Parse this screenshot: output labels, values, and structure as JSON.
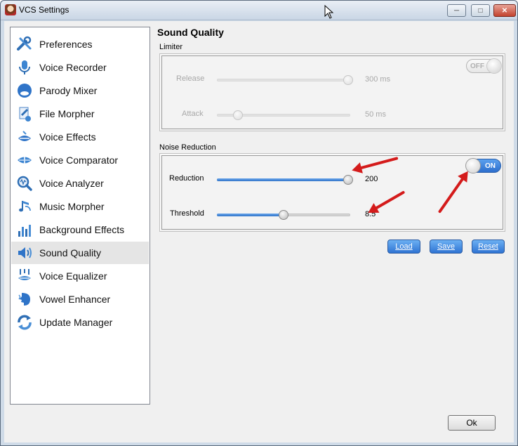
{
  "window": {
    "title": "VCS Settings"
  },
  "sidebar": {
    "items": [
      {
        "label": "Preferences",
        "icon": "tools-icon"
      },
      {
        "label": "Voice Recorder",
        "icon": "microphone-icon"
      },
      {
        "label": "Parody Mixer",
        "icon": "face-icon"
      },
      {
        "label": "File Morpher",
        "icon": "file-icon"
      },
      {
        "label": "Voice Effects",
        "icon": "lips-icon"
      },
      {
        "label": "Voice Comparator",
        "icon": "comparator-icon"
      },
      {
        "label": "Voice Analyzer",
        "icon": "analyzer-icon"
      },
      {
        "label": "Music Morpher",
        "icon": "music-icon"
      },
      {
        "label": "Background Effects",
        "icon": "bars-icon"
      },
      {
        "label": "Sound Quality",
        "icon": "speaker-icon"
      },
      {
        "label": "Voice Equalizer",
        "icon": "equalizer-icon"
      },
      {
        "label": "Vowel Enhancer",
        "icon": "head-icon"
      },
      {
        "label": "Update Manager",
        "icon": "refresh-icon"
      }
    ],
    "selected": "Sound Quality"
  },
  "main": {
    "title": "Sound Quality",
    "limiter": {
      "label": "Limiter",
      "toggle": "OFF",
      "release": {
        "label": "Release",
        "value": "300 ms",
        "level": 1.0
      },
      "attack": {
        "label": "Attack",
        "value": "50 ms",
        "level": 0.16
      }
    },
    "noise_reduction": {
      "label": "Noise Reduction",
      "toggle": "ON",
      "reduction": {
        "label": "Reduction",
        "value": "200",
        "level": 1.0
      },
      "threshold": {
        "label": "Threshold",
        "value": "8.5",
        "level": 0.5
      }
    },
    "buttons": {
      "load": "Load",
      "save": "Save",
      "reset": "Reset"
    }
  },
  "footer": {
    "ok": "Ok"
  },
  "colors": {
    "accent": "#2e73c9",
    "arrow": "#d41b1b"
  }
}
